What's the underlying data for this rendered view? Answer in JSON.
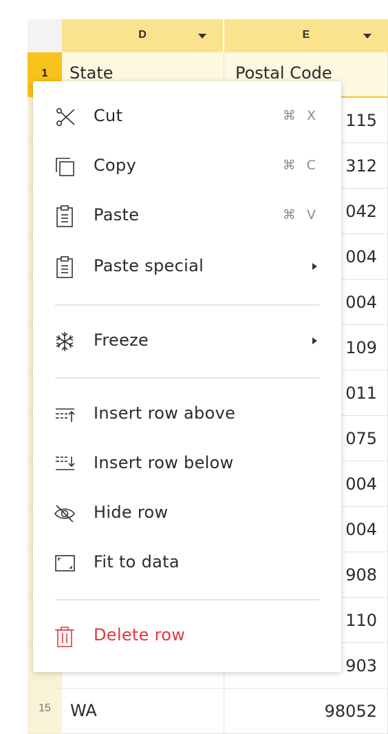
{
  "grid": {
    "columns": [
      {
        "letter": "D"
      },
      {
        "letter": "E"
      }
    ],
    "header_row": {
      "number": "1",
      "state": "State",
      "postal": "Postal Code"
    },
    "postal_partial": [
      "115",
      "312",
      "042",
      "004",
      "004",
      "109",
      "011",
      "075",
      "004",
      "004",
      "908",
      "110",
      "903"
    ],
    "last_row": {
      "number": "15",
      "state": "WA",
      "postal": "98052"
    }
  },
  "context_menu": {
    "cut": {
      "label": "Cut",
      "shortcut": "⌘ X",
      "icon": "scissors-icon"
    },
    "copy": {
      "label": "Copy",
      "shortcut": "⌘ C",
      "icon": "copy-icon"
    },
    "paste": {
      "label": "Paste",
      "shortcut": "⌘ V",
      "icon": "clipboard-icon"
    },
    "paste_special": {
      "label": "Paste special",
      "icon": "clipboard-icon"
    },
    "freeze": {
      "label": "Freeze",
      "icon": "snowflake-icon"
    },
    "insert_above": {
      "label": "Insert row above",
      "icon": "insert-row-above-icon"
    },
    "insert_below": {
      "label": "Insert row below",
      "icon": "insert-row-below-icon"
    },
    "hide_row": {
      "label": "Hide row",
      "icon": "eye-slash-icon"
    },
    "fit_to_data": {
      "label": "Fit to data",
      "icon": "fit-icon"
    },
    "delete_row": {
      "label": "Delete row",
      "icon": "trash-icon"
    }
  },
  "colors": {
    "column_header": "#fbe38e",
    "active_row_number": "#f7c31c",
    "row_number_bg": "#fbf3d8",
    "danger": "#e5383b"
  }
}
